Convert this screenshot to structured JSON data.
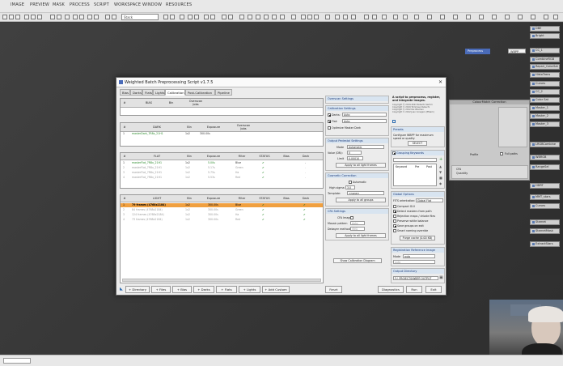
{
  "app": {
    "menus": [
      "IMAGE",
      "PREVIEW",
      "MASK",
      "PROCESS",
      "SCRIPT",
      "WORKSPACE",
      "WINDOW",
      "RESOURCES"
    ],
    "toolbar_combo": "Stack",
    "workspace_items": {
      "selected_process": "Preprocess",
      "image": "WBPP"
    },
    "right_processes": [
      "DBE",
      "Bright",
      "CC_1",
      "CombineRGB",
      "Repair_ColorSat",
      "HistoTrans",
      "Curves",
      "CC_2",
      "Color Sat",
      "Master_1",
      "Master_2",
      "Master_3",
      "LRGBCombine",
      "WBRGB",
      "RangeSel",
      "HDRT",
      "MMT_stars",
      "Curves",
      "Starnet",
      "StarnetMask",
      "ExtractStars"
    ],
    "bg_panel": {
      "title": "ColourMatch Correction",
      "checkbox_label": "Full paths"
    },
    "partial_panel": [
      "CFA",
      "Quantity",
      "Profile"
    ]
  },
  "dialog": {
    "title": "Weighted Batch Preprocessing Script v1.7.5",
    "tabs": [
      "Bias",
      "Darks",
      "Flats",
      "Lights",
      "Calibration",
      "Post-Calibration",
      "Pipeline"
    ],
    "active_tab": "Calibration",
    "bias": {
      "headers": [
        "#",
        "BIAS",
        "Bin",
        "Overscan\nJobs"
      ]
    },
    "darks": {
      "headers": [
        "#",
        "DARK",
        "Bin",
        "Exposure",
        "Overscan\nJobs"
      ],
      "rows": [
        {
          "num": "1",
          "name": "masterDark_7R8x_21H1",
          "bin": "1x2",
          "exposure": "300.00s"
        }
      ]
    },
    "flats": {
      "headers": [
        "#",
        "FLAT",
        "Bin",
        "Exposure",
        "Filter",
        "STATUS",
        "Bias",
        "Dark"
      ],
      "rows": [
        {
          "num": "1",
          "name": "masterFlat_7R8x_21H1",
          "bin": "1x2",
          "exposure": "5.00s",
          "filter": "Blue",
          "status": "✔",
          "bias": "",
          "dark": "-"
        },
        {
          "num": "2",
          "name": "masterFlat_7R8x_21H1",
          "bin": "1x2",
          "exposure": "5.17s",
          "filter": "Green",
          "status": "✔",
          "bias": "",
          "dark": "-"
        },
        {
          "num": "3",
          "name": "masterFlat_7R8x_21H1",
          "bin": "1x2",
          "exposure": "5.75s",
          "filter": "Ha",
          "status": "✔",
          "bias": "",
          "dark": "-"
        },
        {
          "num": "4",
          "name": "masterFlat_7R8x_21H1",
          "bin": "1x2",
          "exposure": "5.53s",
          "filter": "Red",
          "status": "✔",
          "bias": "",
          "dark": "-"
        }
      ]
    },
    "lights": {
      "headers": [
        "#",
        "LIGHT",
        "Bin",
        "Exposure",
        "Filter",
        "STATUS",
        "Bias",
        "Dark"
      ],
      "rows": [
        {
          "num": "1",
          "name": "79 frames (4768x2184)",
          "bin": "1x2",
          "exposure": "300.00s",
          "filter": "Blue",
          "status": "✔",
          "bias": "",
          "dark": "✔",
          "selected": true
        },
        {
          "num": "2",
          "name": "84 frames (4768x2184)",
          "bin": "1x2",
          "exposure": "300.00s",
          "filter": "Green",
          "status": "✔",
          "bias": "",
          "dark": "✔"
        },
        {
          "num": "3",
          "name": "124 frames (4768x2184)",
          "bin": "1x2",
          "exposure": "300.00s",
          "filter": "Ha",
          "status": "✔",
          "bias": "",
          "dark": "✔"
        },
        {
          "num": "4",
          "name": "73 frames (4768x2184)",
          "bin": "1x2",
          "exposure": "300.00s",
          "filter": "Red",
          "status": "✔",
          "bias": "",
          "dark": "✔"
        }
      ]
    },
    "middle": {
      "overscan": "Overscan Settings",
      "calibration": "Calibration Settings",
      "darks_label": "Darks:",
      "darks_value": "Auto",
      "flats_label": "Flat:",
      "flats_value": "Auto",
      "optimize": "Optimize Master Dark",
      "output_pedestal": "Output Pedestal Settings",
      "mode_label": "Mode",
      "mode_value": "Automatic",
      "value_label": "Value (DN):",
      "value_value": "0",
      "limit_label": "Limit",
      "limit_value": "0.00010",
      "apply_all_light": "Apply to all light frames",
      "cosmetic": "Cosmetic Correction",
      "automatic_label": "Automatic",
      "high_sigma_label": "High sigma",
      "high_sigma_value": "3.0",
      "template_label": "Template:",
      "template_value": "<none>",
      "apply_all_groups": "Apply to all groups",
      "cfa": "CFA Settings",
      "cfa_images": "CFA Images",
      "mosaic_label": "Mosaic pattern",
      "mosaic_value": "Auto",
      "debayer_label": "Debayer method",
      "debayer_value": "VNG",
      "apply_all_light2": "Apply to all light frames",
      "show_diagram": "Show Calibration Diagram"
    },
    "right": {
      "description": "A script to preprocess, register, and integrate images.",
      "version_lines": [
        "Copyright © 2019-2022 Roberto Sartori",
        "Copyright © 2019 Tommaso Rubechi",
        "Copyright © 2012 Kai Wiechen",
        "Copyright © 2012 Juan Conejero (PTeam)"
      ],
      "presets": "Presets",
      "presets_text": "Configure WBPP for maximum speed or quality",
      "select": "SELECT",
      "grouping": "Grouping Keywords",
      "kw_headers": [
        "Keyword",
        "Pre",
        "Post"
      ],
      "global_options": "Global Options",
      "fits_orientation": "FITS orientation:",
      "fits_value": "Global Flat",
      "compact_gui": "Compact GUI",
      "detect_masters": "Detect masters from path",
      "rejection_maps": "Rejection maps / drizzle files",
      "preserve_wb": "Preserve white balance",
      "save_groups": "Save groups on exit",
      "smart_naming": "Smart naming override",
      "purge_cache": "Purge cache (0.00 KB)",
      "registration_ref": "Registration Reference Image",
      "mode_label": "Mode",
      "mode_value": "auto",
      "ref_value": "auto",
      "output_dir": "Output Directory",
      "output_path": "F:/_PROJECTS/WBPP OUTPUT"
    },
    "bottom_buttons": [
      "+ Directory",
      "+ Files",
      "+ Bias",
      "+ Darks",
      "+ Flats",
      "+ Lights",
      "+ Add Custom"
    ],
    "reset": "Reset",
    "diagnostics": "Diagnostics",
    "run": "Run",
    "exit": "Exit"
  },
  "colors": {
    "selected_row": "#f0a040",
    "status_ok": "#2a8a2a",
    "section_header": "#1a3a7a"
  }
}
